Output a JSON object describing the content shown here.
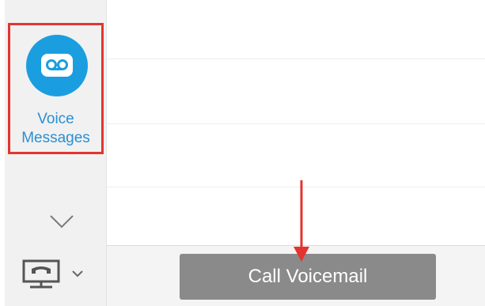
{
  "sidebar": {
    "voice_messages": {
      "label_line1": "Voice",
      "label_line2": "Messages",
      "icon": "voicemail-icon"
    },
    "expand_icon": "chevron-down-icon",
    "screen_share_icon": "screen-share-icon"
  },
  "bottom_bar": {
    "call_voicemail_label": "Call Voicemail"
  },
  "colors": {
    "accent": "#1a9ee0",
    "highlight": "#e3342f",
    "button": "#8a8a8a"
  }
}
